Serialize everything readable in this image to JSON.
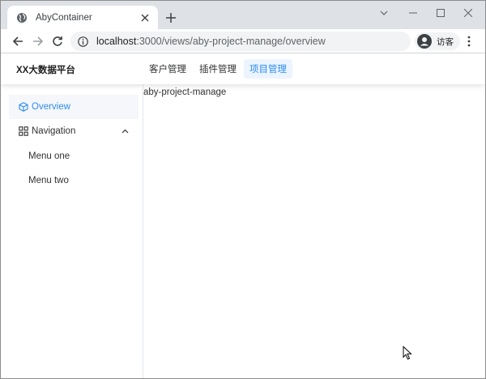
{
  "browser": {
    "tab": {
      "title": "AbyContainer"
    },
    "url": {
      "host": "localhost",
      "path": ":3000/views/aby-project-manage/overview"
    },
    "profile": {
      "label": "访客"
    }
  },
  "app": {
    "brand": "XX大数据平台",
    "topnav": [
      {
        "label": "客户管理",
        "active": false
      },
      {
        "label": "插件管理",
        "active": false
      },
      {
        "label": "项目管理",
        "active": true
      }
    ],
    "sidebar": {
      "overview": {
        "label": "Overview",
        "icon": "cube-icon",
        "active": true
      },
      "navigation": {
        "label": "Navigation",
        "icon": "grid-icon",
        "expanded": true
      },
      "submenu": [
        {
          "label": "Menu one"
        },
        {
          "label": "Menu two"
        }
      ]
    },
    "main": {
      "text": "aby-project-manage"
    },
    "colors": {
      "accent": "#2d8cf0",
      "active_bg": "#ecf5ff"
    }
  }
}
